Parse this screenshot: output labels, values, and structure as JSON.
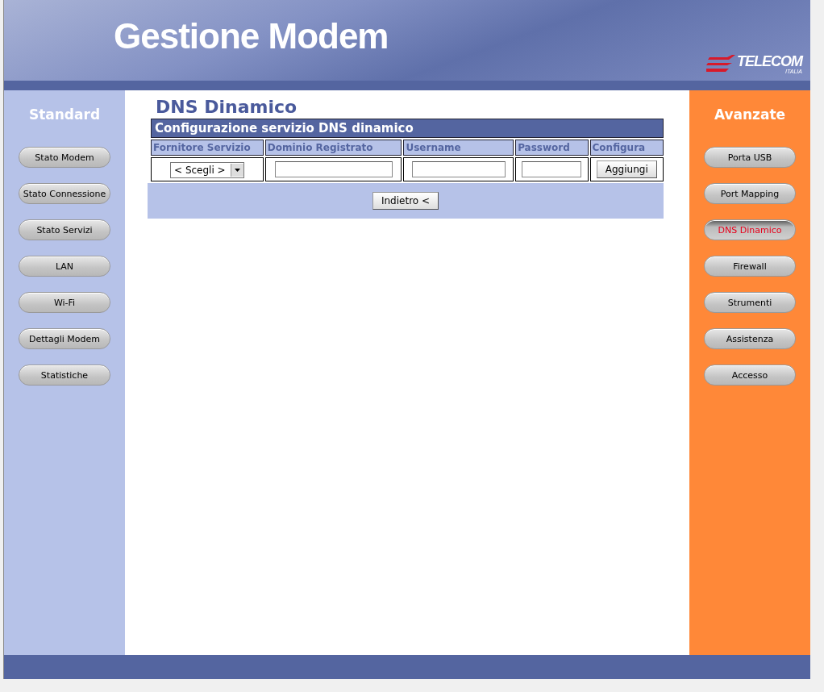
{
  "header": {
    "title": "Gestione Modem",
    "logo": {
      "name": "TELECOM",
      "subtitle": "ITALIA"
    }
  },
  "left_panel": {
    "title": "Standard",
    "items": [
      {
        "label": "Stato Modem",
        "selected": false
      },
      {
        "label": "Stato Connessione",
        "selected": false
      },
      {
        "label": "Stato Servizi",
        "selected": false
      },
      {
        "label": "LAN",
        "selected": false
      },
      {
        "label": "Wi-Fi",
        "selected": false
      },
      {
        "label": "Dettagli Modem",
        "selected": false
      },
      {
        "label": "Statistiche",
        "selected": false
      }
    ]
  },
  "main": {
    "title": "DNS Dinamico",
    "table": {
      "title": "Configurazione servizio DNS dinamico",
      "columns": [
        "Fornitore Servizio",
        "Dominio Registrato",
        "Username",
        "Password",
        "Configura"
      ],
      "row": {
        "provider_select": "< Scegli >",
        "add_button": "Aggiungi"
      }
    },
    "back_button": "Indietro <"
  },
  "right_panel": {
    "title": "Avanzate",
    "items": [
      {
        "label": "Porta USB",
        "selected": false
      },
      {
        "label": "Port Mapping",
        "selected": false
      },
      {
        "label": "DNS Dinamico",
        "selected": true
      },
      {
        "label": "Firewall",
        "selected": false
      },
      {
        "label": "Strumenti",
        "selected": false
      },
      {
        "label": "Assistenza",
        "selected": false
      },
      {
        "label": "Accesso",
        "selected": false
      }
    ]
  }
}
